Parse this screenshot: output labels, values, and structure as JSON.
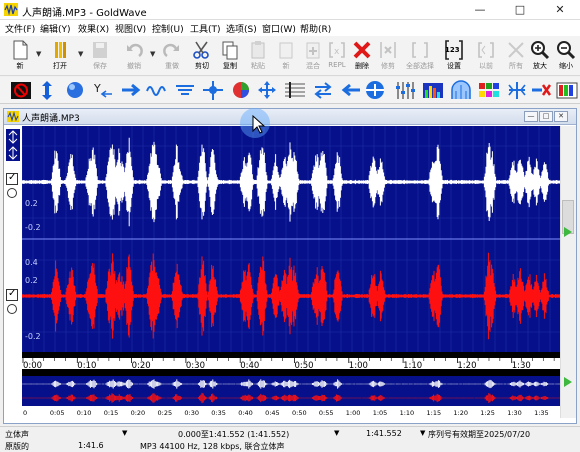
{
  "window": {
    "title": "人声朗诵.MP3 - GoldWave",
    "controls": [
      "—",
      "□",
      "✕"
    ]
  },
  "menu": [
    "文件(F)",
    "编辑(Y)",
    "效果(X)",
    "视图(V)",
    "控制(U)",
    "工具(T)",
    "选项(S)",
    "窗口(W)",
    "帮助(R)"
  ],
  "toolbar": [
    {
      "label": "新",
      "icon": "new-file-icon",
      "enabled": true
    },
    {
      "label": "打开",
      "icon": "open-folder-icon",
      "enabled": true
    },
    {
      "label": "保存",
      "icon": "save-icon",
      "enabled": false
    },
    {
      "label": "撤销",
      "icon": "undo-icon",
      "enabled": false
    },
    {
      "label": "重做",
      "icon": "redo-icon",
      "enabled": false
    },
    {
      "label": "剪切",
      "icon": "scissors-icon",
      "enabled": true
    },
    {
      "label": "复制",
      "icon": "copy-icon",
      "enabled": true
    },
    {
      "label": "粘贴",
      "icon": "paste-icon",
      "enabled": false
    },
    {
      "label": "新",
      "icon": "paste-new-icon",
      "enabled": false
    },
    {
      "label": "混合",
      "icon": "mix-icon",
      "enabled": false
    },
    {
      "label": "REPL",
      "icon": "replace-icon",
      "enabled": false
    },
    {
      "label": "删除",
      "icon": "delete-x-icon",
      "enabled": true
    },
    {
      "label": "修剪",
      "icon": "trim-icon",
      "enabled": false
    },
    {
      "label": "全部选择",
      "icon": "select-all-icon",
      "enabled": false
    },
    {
      "label": "设置",
      "icon": "set-marker-icon",
      "enabled": true
    },
    {
      "label": "以前",
      "icon": "previous-icon",
      "enabled": false
    },
    {
      "label": "所有",
      "icon": "show-all-icon",
      "enabled": false
    },
    {
      "label": "放大",
      "icon": "zoom-in-icon",
      "enabled": true
    },
    {
      "label": "缩小",
      "icon": "zoom-out-icon",
      "enabled": true
    }
  ],
  "set_badge": "123",
  "document": {
    "title": "人声朗诵.MP3",
    "channels": [
      {
        "color": "#ffffff",
        "y_ticks": [
          "0.2",
          "-0.2"
        ]
      },
      {
        "color": "#ff1010",
        "y_ticks": [
          "0.4",
          "0.2",
          "-0.2"
        ]
      }
    ],
    "time_ticks": [
      "0:00",
      "0:10",
      "0:20",
      "0:30",
      "0:40",
      "0:50",
      "1:00",
      "1:10",
      "1:20",
      "1:30"
    ],
    "overview_ticks": [
      "0",
      "0:05",
      "0:10",
      "0:15",
      "0:20",
      "0:25",
      "0:30",
      "0:35",
      "0:40",
      "0:45",
      "0:50",
      "0:55",
      "1:00",
      "1:05",
      "1:10",
      "1:15",
      "1:20",
      "1:25",
      "1:30",
      "1:35"
    ]
  },
  "status": {
    "channel_mode": "立体声",
    "selection": "0.000至1:41.552 (1:41.552)",
    "length": "1:41.552",
    "registration": "序列号有效期至2025/07/20",
    "original_label": "原版的",
    "original_value": "1:41.6",
    "format": "MP3 44100 Hz, 128 kbps, 联合立体声"
  }
}
